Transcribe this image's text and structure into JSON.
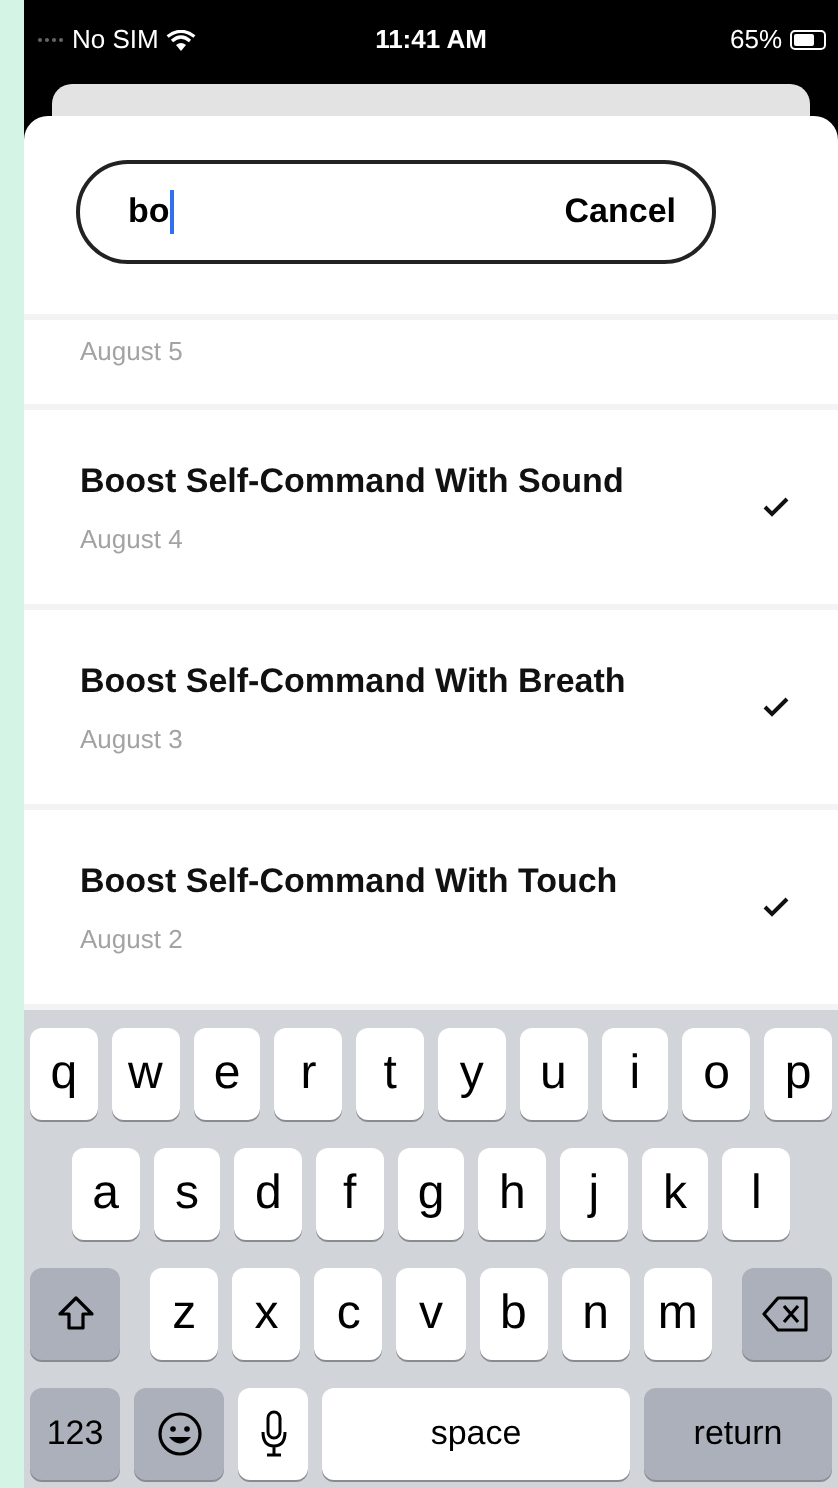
{
  "status_bar": {
    "carrier": "No SIM",
    "time": "11:41 AM",
    "battery": "65%"
  },
  "search": {
    "value": "bo",
    "cancel": "Cancel"
  },
  "items": [
    {
      "date": "August 5"
    },
    {
      "title": "Boost Self-Command With Sound",
      "date": "August 4",
      "checked": true
    },
    {
      "title": "Boost Self-Command With Breath",
      "date": "August 3",
      "checked": true
    },
    {
      "title": "Boost Self-Command With Touch",
      "date": "August 2",
      "checked": true
    }
  ],
  "keyboard": {
    "top_row": [
      {
        "kind": "letter",
        "label": "q"
      },
      {
        "kind": "letter",
        "label": "w"
      },
      {
        "kind": "letter",
        "label": "e"
      },
      {
        "kind": "letter",
        "label": "r"
      },
      {
        "kind": "letter",
        "label": "t"
      },
      {
        "kind": "letter",
        "label": "y"
      },
      {
        "kind": "letter",
        "label": "u"
      },
      {
        "kind": "letter",
        "label": "i"
      },
      {
        "kind": "letter",
        "label": "o"
      },
      {
        "kind": "letter",
        "label": "p"
      }
    ],
    "middle_row": [
      {
        "kind": "letter",
        "label": "a"
      },
      {
        "kind": "letter",
        "label": "s"
      },
      {
        "kind": "letter",
        "label": "d"
      },
      {
        "kind": "letter",
        "label": "f"
      },
      {
        "kind": "letter",
        "label": "g"
      },
      {
        "kind": "letter",
        "label": "h"
      },
      {
        "kind": "letter",
        "label": "j"
      },
      {
        "kind": "letter",
        "label": "k"
      },
      {
        "kind": "letter",
        "label": "l"
      }
    ],
    "lower_row": [
      {
        "kind": "shift"
      },
      {
        "kind": "letter",
        "label": "z"
      },
      {
        "kind": "letter",
        "label": "x"
      },
      {
        "kind": "letter",
        "label": "c"
      },
      {
        "kind": "letter",
        "label": "v"
      },
      {
        "kind": "letter",
        "label": "b"
      },
      {
        "kind": "letter",
        "label": "n"
      },
      {
        "kind": "letter",
        "label": "m"
      },
      {
        "kind": "delete"
      }
    ],
    "bottom_row": [
      {
        "kind": "numbers",
        "label": "123"
      },
      {
        "kind": "emoji"
      },
      {
        "kind": "mic"
      },
      {
        "kind": "space",
        "label": "space"
      },
      {
        "kind": "return",
        "label": "return"
      }
    ]
  }
}
